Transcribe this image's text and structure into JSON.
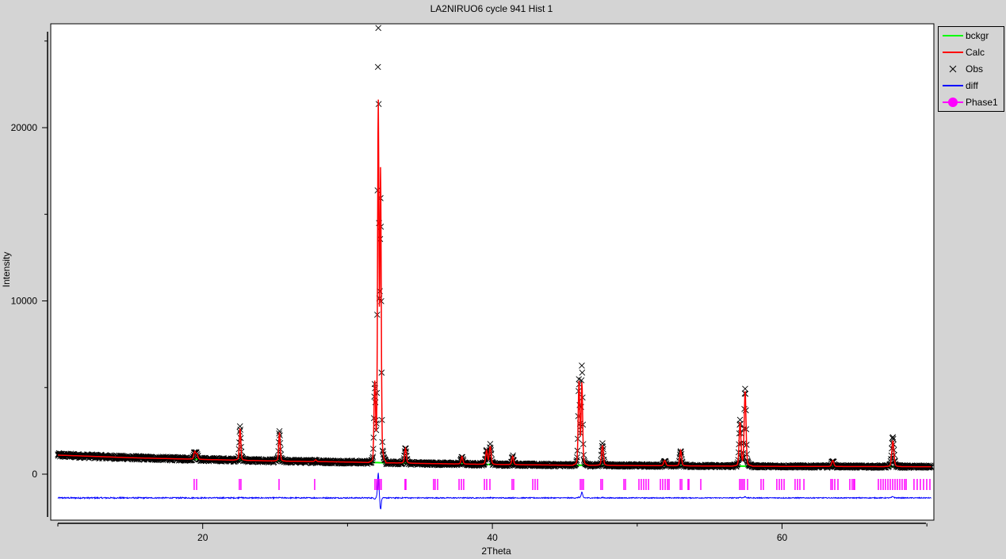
{
  "chart_data": {
    "type": "line",
    "title": "LA2NIRUO6 cycle 941 Hist 1",
    "xlabel": "2Theta",
    "ylabel": "Intensity",
    "xlim": [
      10,
      70.3
    ],
    "ylim": [
      -2500,
      25900
    ],
    "xticks": [
      {
        "value": 20,
        "label": "20"
      },
      {
        "value": 40,
        "label": "40"
      },
      {
        "value": 60,
        "label": "60"
      }
    ],
    "xminor_ticks": [
      10,
      30,
      50,
      70
    ],
    "yticks": [
      {
        "value": 0,
        "label": "0"
      },
      {
        "value": 10000,
        "label": "10000"
      },
      {
        "value": 20000,
        "label": "20000"
      }
    ],
    "yminor_ticks": [
      5000,
      15000,
      25000
    ],
    "legend": {
      "placement": "outside-top-right",
      "entries": [
        {
          "label": "bckgr",
          "color": "#00ff00",
          "style": "line"
        },
        {
          "label": "Calc",
          "color": "#ff0000",
          "style": "line"
        },
        {
          "label": "Obs",
          "color": "#000000",
          "style": "x-marker"
        },
        {
          "label": "diff",
          "color": "#0000ff",
          "style": "line"
        },
        {
          "label": "Phase1",
          "color": "#ff00ff",
          "style": "line-circle"
        }
      ]
    },
    "step": 0.025,
    "diff_offset": -1370,
    "background": [
      [
        10,
        1100
      ],
      [
        15,
        950
      ],
      [
        20,
        850
      ],
      [
        25,
        760
      ],
      [
        30,
        700
      ],
      [
        35,
        620
      ],
      [
        40,
        560
      ],
      [
        45,
        520
      ],
      [
        50,
        500
      ],
      [
        55,
        470
      ],
      [
        60,
        450
      ],
      [
        65,
        440
      ],
      [
        70.3,
        430
      ]
    ],
    "peaks": [
      {
        "two_theta": 19.45,
        "obs": 450,
        "calc": 430,
        "sigma": 0.06
      },
      {
        "two_theta": 19.6,
        "obs": 300,
        "calc": 300,
        "sigma": 0.06
      },
      {
        "two_theta": 22.58,
        "obs": 2000,
        "calc": 1850,
        "sigma": 0.05
      },
      {
        "two_theta": 25.3,
        "obs": 1700,
        "calc": 1650,
        "sigma": 0.05
      },
      {
        "two_theta": 27.8,
        "obs": 100,
        "calc": 100,
        "sigma": 0.06
      },
      {
        "two_theta": 31.88,
        "obs": 4300,
        "calc": 4500,
        "sigma": 0.05
      },
      {
        "two_theta": 32.12,
        "obs": 24800,
        "calc": 20500,
        "sigma": 0.045
      },
      {
        "two_theta": 32.28,
        "obs": 14500,
        "calc": 16500,
        "sigma": 0.045
      },
      {
        "two_theta": 34.0,
        "obs": 900,
        "calc": 850,
        "sigma": 0.06
      },
      {
        "two_theta": 37.9,
        "obs": 450,
        "calc": 430,
        "sigma": 0.06
      },
      {
        "two_theta": 39.6,
        "obs": 800,
        "calc": 780,
        "sigma": 0.06
      },
      {
        "two_theta": 39.85,
        "obs": 1100,
        "calc": 1050,
        "sigma": 0.06
      },
      {
        "two_theta": 41.4,
        "obs": 500,
        "calc": 480,
        "sigma": 0.06
      },
      {
        "two_theta": 45.98,
        "obs": 4900,
        "calc": 4800,
        "sigma": 0.05
      },
      {
        "two_theta": 46.18,
        "obs": 5600,
        "calc": 4700,
        "sigma": 0.05
      },
      {
        "two_theta": 47.6,
        "obs": 1200,
        "calc": 1150,
        "sigma": 0.06
      },
      {
        "two_theta": 51.9,
        "obs": 300,
        "calc": 300,
        "sigma": 0.07
      },
      {
        "two_theta": 53.0,
        "obs": 900,
        "calc": 880,
        "sigma": 0.06
      },
      {
        "two_theta": 57.1,
        "obs": 2600,
        "calc": 2500,
        "sigma": 0.06
      },
      {
        "two_theta": 57.45,
        "obs": 4500,
        "calc": 4300,
        "sigma": 0.06
      },
      {
        "two_theta": 63.5,
        "obs": 350,
        "calc": 340,
        "sigma": 0.07
      },
      {
        "two_theta": 67.65,
        "obs": 1700,
        "calc": 1500,
        "sigma": 0.07
      }
    ],
    "reflections_phase1": [
      19.41,
      19.58,
      22.53,
      22.64,
      25.27,
      27.73,
      31.89,
      32.0,
      32.11,
      32.22,
      32.33,
      33.97,
      34.03,
      35.94,
      36.05,
      36.22,
      37.7,
      37.86,
      38.02,
      39.45,
      39.61,
      39.83,
      41.36,
      41.47,
      42.79,
      42.95,
      43.12,
      46.07,
      46.18,
      46.29,
      47.49,
      47.6,
      49.08,
      49.19,
      50.12,
      50.28,
      50.45,
      50.61,
      50.78,
      51.6,
      51.76,
      51.93,
      52.09,
      52.2,
      52.97,
      53.08,
      53.51,
      53.57,
      54.39,
      57.07,
      57.18,
      57.29,
      57.4,
      57.62,
      58.55,
      58.71,
      59.64,
      59.81,
      59.97,
      60.14,
      60.9,
      61.07,
      61.23,
      61.51,
      63.37,
      63.48,
      63.64,
      63.86,
      64.68,
      64.84,
      64.95,
      65.01,
      66.65,
      66.82,
      66.98,
      67.14,
      67.31,
      67.47,
      67.64,
      67.8,
      67.96,
      68.13,
      68.29,
      68.46,
      68.57,
      69.11,
      69.33,
      69.55,
      69.77,
      69.99,
      70.21
    ]
  }
}
